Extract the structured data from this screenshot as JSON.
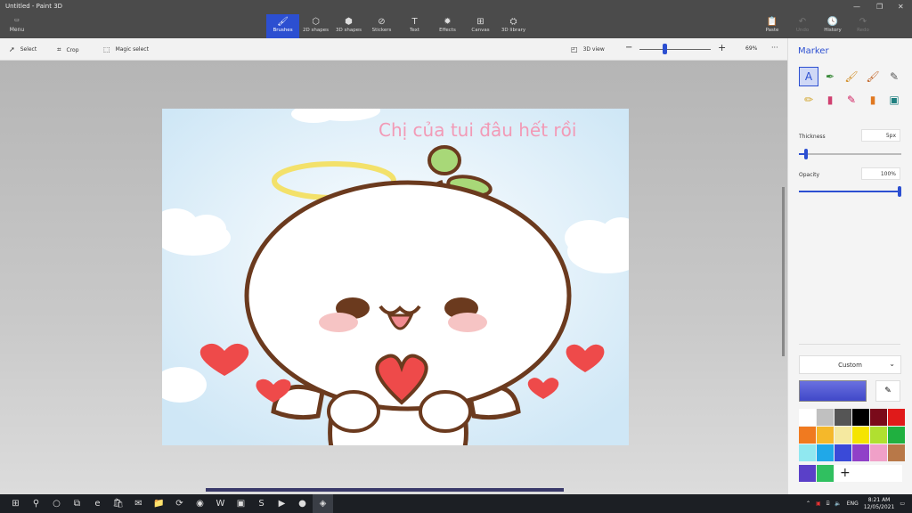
{
  "window": {
    "title": "Untitled - Paint 3D"
  },
  "menu": {
    "label": "Menu"
  },
  "tools": [
    {
      "label": "Brushes",
      "icon": "brush-icon",
      "glyph": "🖌"
    },
    {
      "label": "2D shapes",
      "icon": "2d-shapes-icon",
      "glyph": "⬡"
    },
    {
      "label": "3D shapes",
      "icon": "3d-shapes-icon",
      "glyph": "⬢"
    },
    {
      "label": "Stickers",
      "icon": "stickers-icon",
      "glyph": "⊘"
    },
    {
      "label": "Text",
      "icon": "text-icon",
      "glyph": "T"
    },
    {
      "label": "Effects",
      "icon": "effects-icon",
      "glyph": "✹"
    },
    {
      "label": "Canvas",
      "icon": "canvas-icon",
      "glyph": "⊞"
    },
    {
      "label": "3D library",
      "icon": "3d-library-icon",
      "glyph": "⛭"
    }
  ],
  "right_tools": [
    {
      "label": "Paste",
      "icon": "paste-icon",
      "glyph": "📋"
    },
    {
      "label": "Undo",
      "icon": "undo-icon",
      "glyph": "↶"
    },
    {
      "label": "History",
      "icon": "history-icon",
      "glyph": "🕓"
    },
    {
      "label": "Redo",
      "icon": "redo-icon",
      "glyph": "↷"
    }
  ],
  "toolbar": {
    "select": "Select",
    "crop": "Crop",
    "magic_select": "Magic select",
    "view3d": "3D view",
    "zoom": "69%",
    "more": "···"
  },
  "canvas": {
    "caption": "Chị của tui đâu hết rồi"
  },
  "panel": {
    "title": "Marker",
    "thickness_label": "Thickness",
    "thickness_value": "5px",
    "thickness_level": 0.05,
    "opacity_label": "Opacity",
    "opacity_value": "100%",
    "opacity_level": 1.0,
    "color_mode": "Custom",
    "current_color": "#4048c8",
    "brushes": [
      {
        "name": "marker-brush",
        "icon": "marker-icon",
        "glyph": "A",
        "color": "#2c4fd1"
      },
      {
        "name": "calligraphy-pen",
        "icon": "calligraphy-pen-icon",
        "glyph": "✒",
        "color": "#3a8a3a"
      },
      {
        "name": "oil-brush",
        "icon": "oil-brush-icon",
        "glyph": "🖌",
        "color": "#d08a20"
      },
      {
        "name": "watercolor",
        "icon": "watercolor-icon",
        "glyph": "🖌",
        "color": "#c06020"
      },
      {
        "name": "pixel-pen",
        "icon": "pixel-pen-icon",
        "glyph": "✎",
        "color": "#555555"
      },
      {
        "name": "pencil",
        "icon": "pencil-icon",
        "glyph": "✏",
        "color": "#d0a020"
      },
      {
        "name": "eraser",
        "icon": "eraser-icon",
        "glyph": "▮",
        "color": "#d04070"
      },
      {
        "name": "crayon",
        "icon": "crayon-icon",
        "glyph": "✎",
        "color": "#d02060"
      },
      {
        "name": "spray-can",
        "icon": "spray-can-icon",
        "glyph": "▮",
        "color": "#e07820"
      },
      {
        "name": "fill",
        "icon": "fill-icon",
        "glyph": "▣",
        "color": "#208080"
      }
    ],
    "palette": [
      "#ffffff",
      "#c0c0c0",
      "#555555",
      "#000000",
      "#7a0a1a",
      "#e01a1a",
      "#f07a20",
      "#f5b82a",
      "#f5e9a0",
      "#f5e400",
      "#b0e030",
      "#20b040",
      "#90e8f0",
      "#20a8e8",
      "#3a4ad8",
      "#9040c8",
      "#f0a0c8",
      "#b87848"
    ],
    "custom_colors": [
      "#5a40c8",
      "#30c060"
    ],
    "add_label": "+"
  },
  "taskbar": {
    "time": "8:21 AM",
    "date": "12/05/2021",
    "lang": "ENG",
    "apps": [
      {
        "icon": "start-icon",
        "glyph": "⊞"
      },
      {
        "icon": "search-icon",
        "glyph": "⚲"
      },
      {
        "icon": "cortana-icon",
        "glyph": "○"
      },
      {
        "icon": "task-view-icon",
        "glyph": "⧉"
      },
      {
        "icon": "edge-icon",
        "glyph": "e"
      },
      {
        "icon": "store-icon",
        "glyph": "🛍"
      },
      {
        "icon": "mail-icon",
        "glyph": "✉"
      },
      {
        "icon": "file-explorer-icon",
        "glyph": "📁"
      },
      {
        "icon": "green-app-icon",
        "glyph": "⟳"
      },
      {
        "icon": "chrome-icon",
        "glyph": "◉"
      },
      {
        "icon": "word-icon",
        "glyph": "W"
      },
      {
        "icon": "photos-icon",
        "glyph": "▣"
      },
      {
        "icon": "skype-icon",
        "glyph": "S"
      },
      {
        "icon": "zoom-icon",
        "glyph": "▶"
      },
      {
        "icon": "record-icon",
        "glyph": "●"
      },
      {
        "icon": "paint3d-icon",
        "glyph": "◈"
      }
    ]
  }
}
